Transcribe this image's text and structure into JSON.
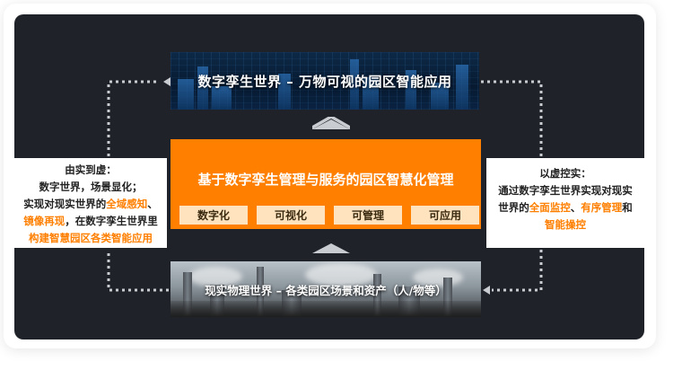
{
  "top_banner": {
    "title": "数字孪生世界 – 万物可视的园区智能应用"
  },
  "core": {
    "title": "基于数字孪生管理与服务的园区智慧化管理",
    "chips": [
      "数字化",
      "可视化",
      "可管理",
      "可应用"
    ]
  },
  "bottom_banner": {
    "title": "现实物理世界 – 各类园区场景和资产（人/物等）"
  },
  "left_box": {
    "line1": "由实到虚：",
    "line2": "数字世界，场景显化；",
    "line3_a": "实现对现实世界的",
    "line3_hl": "全域感知",
    "line3_b": "、",
    "line4_hl": "镜像再现",
    "line4_b": "，在数字孪生世界里",
    "line5_hl": "构建智慧园区各类智能应用"
  },
  "right_box": {
    "line1": "以虚控实：",
    "line2": "通过数字孪生世界实现对现实",
    "line3_a": "世界的",
    "line3_hl1": "全面监控",
    "line3_b": "、",
    "line3_hl2": "有序管理",
    "line3_c": "和",
    "line4_hl": "智能操控"
  },
  "colors": {
    "accent": "#ff7f00",
    "panel": "#1f2329",
    "chip": "#ffe3bf"
  }
}
